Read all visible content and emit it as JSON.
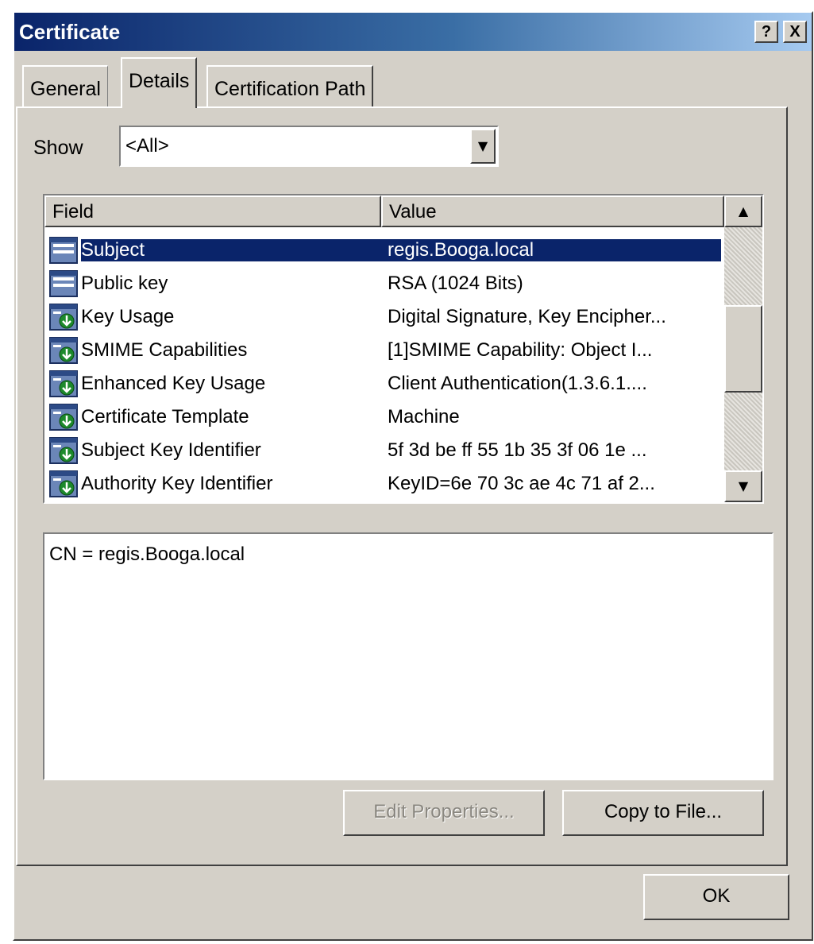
{
  "window": {
    "title": "Certificate",
    "help_glyph": "?",
    "close_glyph": "X"
  },
  "tabs": [
    {
      "label": "General",
      "selected": false
    },
    {
      "label": "Details",
      "selected": true
    },
    {
      "label": "Certification Path",
      "selected": false
    }
  ],
  "show": {
    "label": "Show",
    "value": "<All>",
    "arrow": "▼"
  },
  "list": {
    "columns": {
      "field": "Field",
      "value": "Value"
    },
    "rows": [
      {
        "field": "Subject",
        "value": "regis.Booga.local",
        "icon": "certificate-field-icon",
        "selected": true
      },
      {
        "field": "Public key",
        "value": "RSA (1024 Bits)",
        "icon": "certificate-field-icon",
        "selected": false
      },
      {
        "field": "Key Usage",
        "value": "Digital Signature, Key Encipher...",
        "icon": "certificate-extension-icon",
        "selected": false
      },
      {
        "field": "SMIME Capabilities",
        "value": "[1]SMIME Capability: Object I...",
        "icon": "certificate-extension-icon",
        "selected": false
      },
      {
        "field": "Enhanced Key Usage",
        "value": "Client Authentication(1.3.6.1....",
        "icon": "certificate-extension-icon",
        "selected": false
      },
      {
        "field": "Certificate Template",
        "value": "Machine",
        "icon": "certificate-extension-icon",
        "selected": false
      },
      {
        "field": "Subject Key Identifier",
        "value": "5f 3d be ff 55 1b 35 3f 06 1e ...",
        "icon": "certificate-extension-icon",
        "selected": false
      },
      {
        "field": "Authority Key Identifier",
        "value": "KeyID=6e 70 3c ae 4c 71 af 2...",
        "icon": "certificate-extension-icon",
        "selected": false
      }
    ],
    "scroll_up": "▲",
    "scroll_down": "▼"
  },
  "detail": {
    "text": "CN = regis.Booga.local"
  },
  "buttons": {
    "edit": "Edit Properties...",
    "copy": "Copy to File...",
    "ok": "OK"
  }
}
